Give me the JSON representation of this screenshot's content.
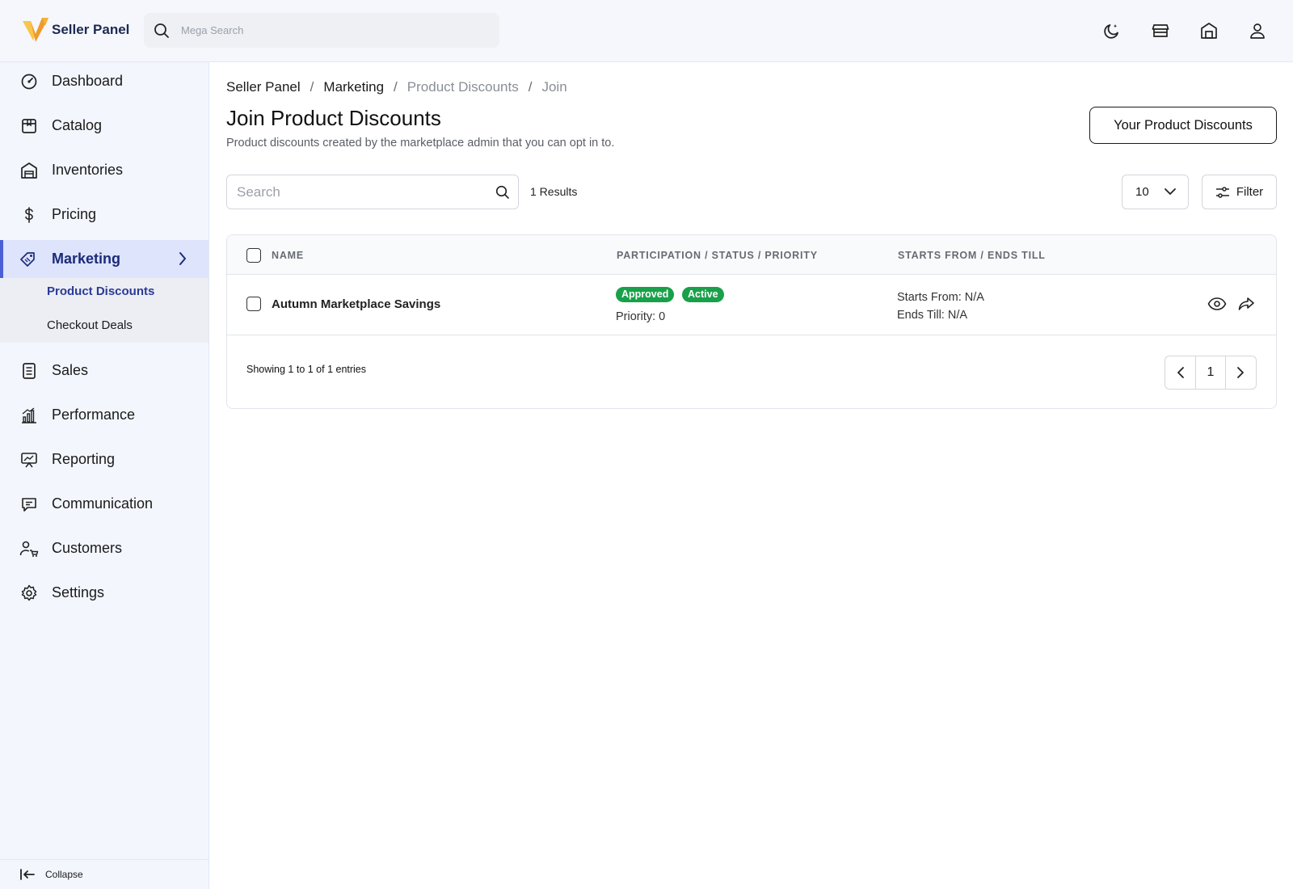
{
  "header": {
    "app_name": "Seller Panel",
    "search_placeholder": "Mega Search",
    "accent_color": "#f5a623"
  },
  "sidebar": {
    "items": [
      {
        "label": "Dashboard",
        "icon": "dashboard-gauge-icon"
      },
      {
        "label": "Catalog",
        "icon": "catalog-box-icon"
      },
      {
        "label": "Inventories",
        "icon": "warehouse-icon"
      },
      {
        "label": "Pricing",
        "icon": "dollar-icon"
      },
      {
        "label": "Marketing",
        "icon": "tag-icon",
        "active": true
      },
      {
        "label": "Sales",
        "icon": "document-icon"
      },
      {
        "label": "Performance",
        "icon": "bar-chart-icon"
      },
      {
        "label": "Reporting",
        "icon": "presentation-icon"
      },
      {
        "label": "Communication",
        "icon": "chat-icon"
      },
      {
        "label": "Customers",
        "icon": "customer-icon"
      },
      {
        "label": "Settings",
        "icon": "gear-icon"
      }
    ],
    "marketing_sub": [
      {
        "label": "Product Discounts",
        "active": true
      },
      {
        "label": "Checkout Deals"
      }
    ],
    "collapse_label": "Collapse"
  },
  "breadcrumb": [
    "Seller Panel",
    "Marketing",
    "Product Discounts",
    "Join"
  ],
  "page": {
    "title": "Join Product Discounts",
    "subtitle": "Product discounts created by the marketplace admin that you can opt in to.",
    "primary_button": "Your Product Discounts"
  },
  "toolbar": {
    "search_placeholder": "Search",
    "results": "1 Results",
    "per_page": "10",
    "filter_label": "Filter"
  },
  "table": {
    "columns": [
      "NAME",
      "PARTICIPATION / STATUS / PRIORITY",
      "STARTS FROM / ENDS TILL"
    ],
    "rows": [
      {
        "name": "Autumn Marketplace Savings",
        "badges": [
          "Approved",
          "Active"
        ],
        "priority": "Priority: 0",
        "starts": "Starts From: N/A",
        "ends": "Ends Till: N/A"
      }
    ],
    "showing": "Showing 1 to 1 of 1 entries",
    "current_page": "1",
    "status_color": "#19a04a"
  }
}
